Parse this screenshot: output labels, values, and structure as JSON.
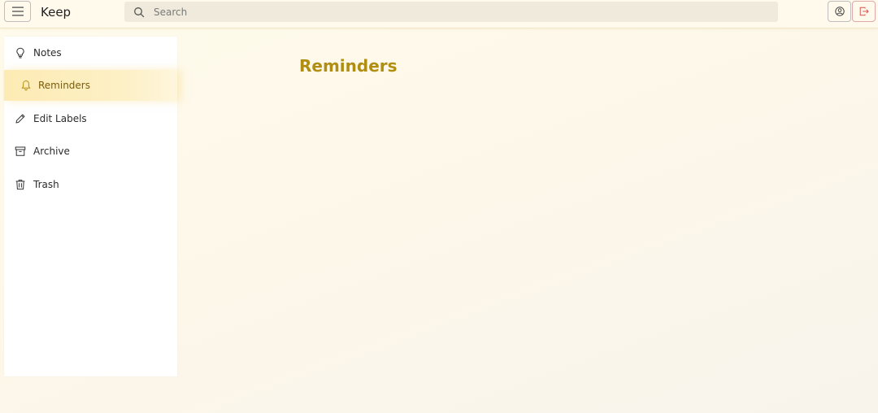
{
  "app": {
    "title": "Keep"
  },
  "header": {
    "search": {
      "placeholder": "Search",
      "value": ""
    },
    "menu_icon": "hamburger-icon",
    "profile_icon": "user-circle-icon",
    "logout_icon": "logout-icon"
  },
  "sidebar": {
    "items": [
      {
        "label": "Notes",
        "icon": "lightbulb-icon",
        "active": false
      },
      {
        "label": "Reminders",
        "icon": "bell-icon",
        "active": true
      },
      {
        "label": "Edit Labels",
        "icon": "pencil-icon",
        "active": false
      },
      {
        "label": "Archive",
        "icon": "archive-icon",
        "active": false
      },
      {
        "label": "Trash",
        "icon": "trash-icon",
        "active": false
      }
    ]
  },
  "main": {
    "heading": "Reminders"
  },
  "colors": {
    "accent": "#b08e12",
    "active_bg": "#fdebb4",
    "logout": "#d9534f"
  }
}
